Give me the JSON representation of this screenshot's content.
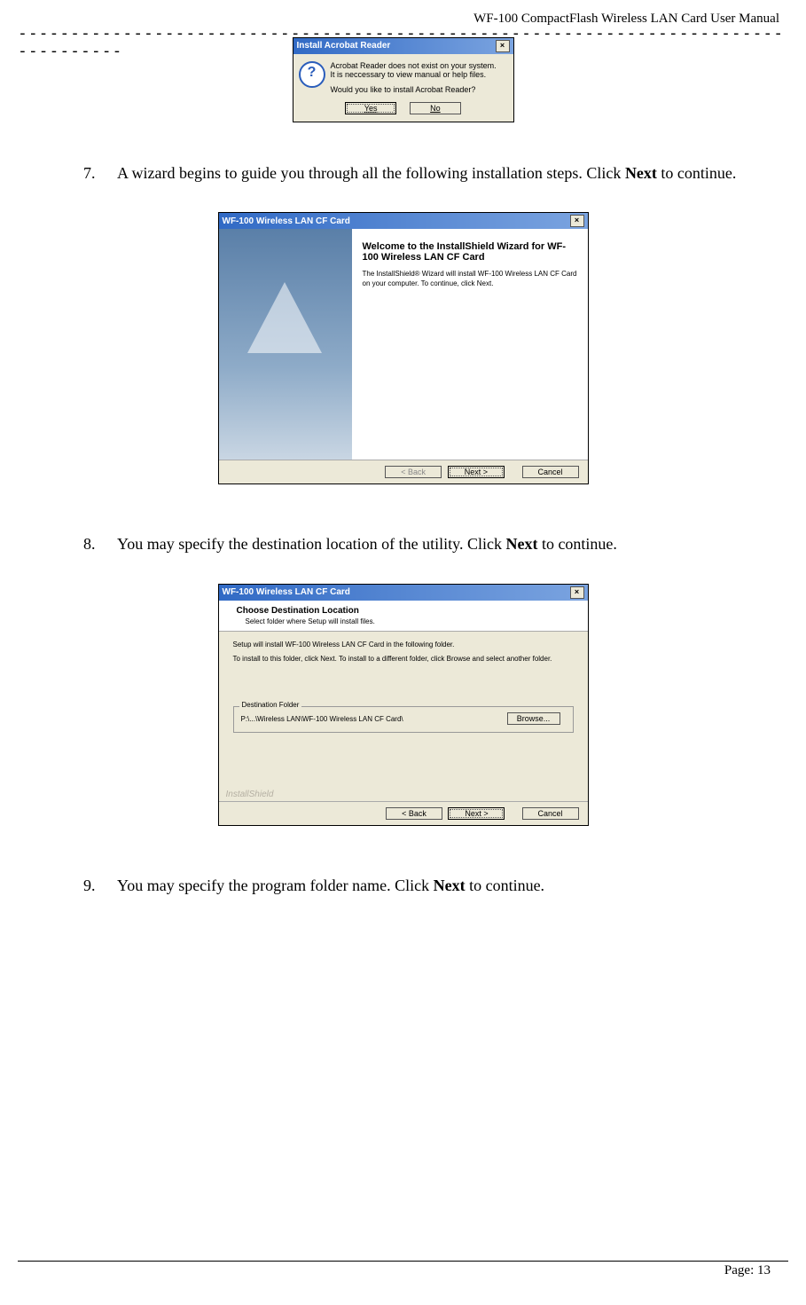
{
  "header": {
    "title": "WF-100 CompactFlash Wireless LAN Card User Manual",
    "dashes": "-----------------------------------------------------------------------------------"
  },
  "acrobat_dialog": {
    "title": "Install Acrobat Reader",
    "line1": "Acrobat Reader does not exist on your system.",
    "line2": "It is neccessary to view manual or help files.",
    "line3": "Would you like to install Acrobat Reader?",
    "yes": "Yes",
    "no": "No"
  },
  "steps": {
    "s7": {
      "num": "7.",
      "text_pre": "A wizard begins to guide you through all the following installation steps. Click ",
      "text_bold": "Next",
      "text_post": " to continue."
    },
    "s8": {
      "num": "8.",
      "text_pre": "You may specify the destination location of the utility. Click ",
      "text_bold": "Next",
      "text_post": " to continue."
    },
    "s9": {
      "num": "9.",
      "text_pre": "You may specify the program folder name. Click ",
      "text_bold": "Next",
      "text_post": " to continue."
    }
  },
  "wizard_welcome": {
    "titlebar": "WF-100 Wireless LAN CF Card",
    "heading": "Welcome to the InstallShield Wizard for WF-100 Wireless LAN CF Card",
    "para": "The InstallShield® Wizard will install WF-100 Wireless LAN CF Card on your computer. To continue, click Next.",
    "back": "< Back",
    "next": "Next >",
    "cancel": "Cancel"
  },
  "wizard_dest": {
    "titlebar": "WF-100 Wireless LAN CF Card",
    "header_title": "Choose Destination Location",
    "header_sub": "Select folder where Setup will install files.",
    "para1": "Setup will install WF-100 Wireless LAN CF Card in the following folder.",
    "para2": "To install to this folder, click Next. To install to a different folder, click Browse and select another folder.",
    "folder_legend": "Destination Folder",
    "folder_path": "P:\\...\\Wireless LAN\\WF-100 Wireless LAN CF Card\\",
    "browse": "Browse...",
    "watermark": "InstallShield",
    "back": "< Back",
    "next": "Next >",
    "cancel": "Cancel"
  },
  "footer": {
    "page": "Page: 13"
  }
}
